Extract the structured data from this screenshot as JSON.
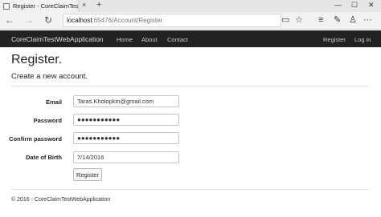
{
  "browser": {
    "tab_title": "Register - CoreClaimTes",
    "tab_close": "×",
    "new_tab": "+",
    "window_controls": {
      "minimize": "—",
      "maximize": "☐",
      "close": "✕"
    },
    "nav": {
      "back": "←",
      "forward": "→",
      "refresh": "↻"
    },
    "address": {
      "host": "localhost",
      "path": ":65476/Account/Register"
    },
    "toolbar_icons": [
      "reading-view-icon",
      "favorite-star-icon",
      "hub-icon",
      "web-note-icon",
      "share-icon",
      "more-icon"
    ],
    "toolbar_glyphs": {
      "reading": "▭",
      "star": "☆",
      "hub": "≡",
      "note": "✎",
      "share": "♙",
      "more": "···"
    }
  },
  "site_nav": {
    "brand": "CoreClaimTestWebApplication",
    "links": [
      "Home",
      "About",
      "Contact"
    ],
    "right_links": [
      "Register",
      "Log in"
    ]
  },
  "main": {
    "title": "Register.",
    "subtitle": "Create a new account.",
    "fields": [
      {
        "label": "Email",
        "value": "Taras.Kholopkin@gmail.com"
      },
      {
        "label": "Password",
        "value": "●●●●●●●●●●●"
      },
      {
        "label": "Confirm password",
        "value": "●●●●●●●●●●●"
      },
      {
        "label": "Date of Birth",
        "value": "7/14/2016"
      }
    ],
    "submit_label": "Register"
  },
  "footer": {
    "text": "© 2016 - CoreClaimTestWebApplication"
  }
}
